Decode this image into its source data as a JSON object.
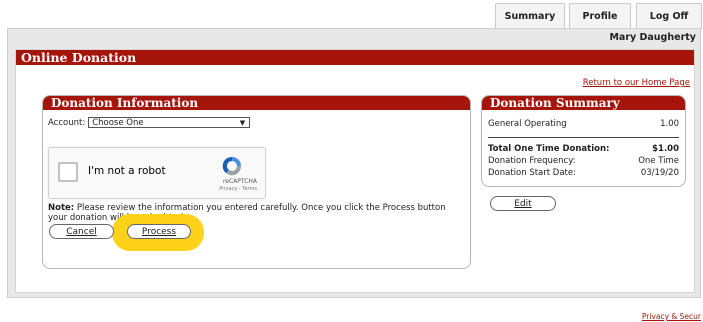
{
  "tabs": [
    {
      "label": "Summary"
    },
    {
      "label": "Profile"
    },
    {
      "label": "Log Off"
    }
  ],
  "user": {
    "name": "Mary Daugherty"
  },
  "page": {
    "title": "Online Donation",
    "home_link": "Return to our Home Page"
  },
  "donation_info": {
    "title": "Donation Information",
    "account_label": "Account:",
    "account_selected": "Choose One",
    "captcha": {
      "label": "I'm not a robot",
      "brand": "reCAPTCHA",
      "legal": "Privacy - Terms"
    },
    "note_label": "Note:",
    "note_text": " Please review the information you entered carefully. Once you click the Process button your donation will be submitted.",
    "cancel_label": "Cancel",
    "process_label": "Process"
  },
  "donation_summary": {
    "title": "Donation Summary",
    "fund_name": "General Operating",
    "fund_amount": "1.00",
    "total_label": "Total One Time Donation:",
    "total_value": "$1.00",
    "frequency_label": "Donation Frequency:",
    "frequency_value": "One Time",
    "start_label": "Donation Start Date:",
    "start_value": "03/19/20",
    "edit_label": "Edit"
  },
  "footer": {
    "privacy_link": "Privacy & Secur"
  },
  "colors": {
    "brand_red": "#a5150b",
    "highlight": "#ffd21a"
  }
}
